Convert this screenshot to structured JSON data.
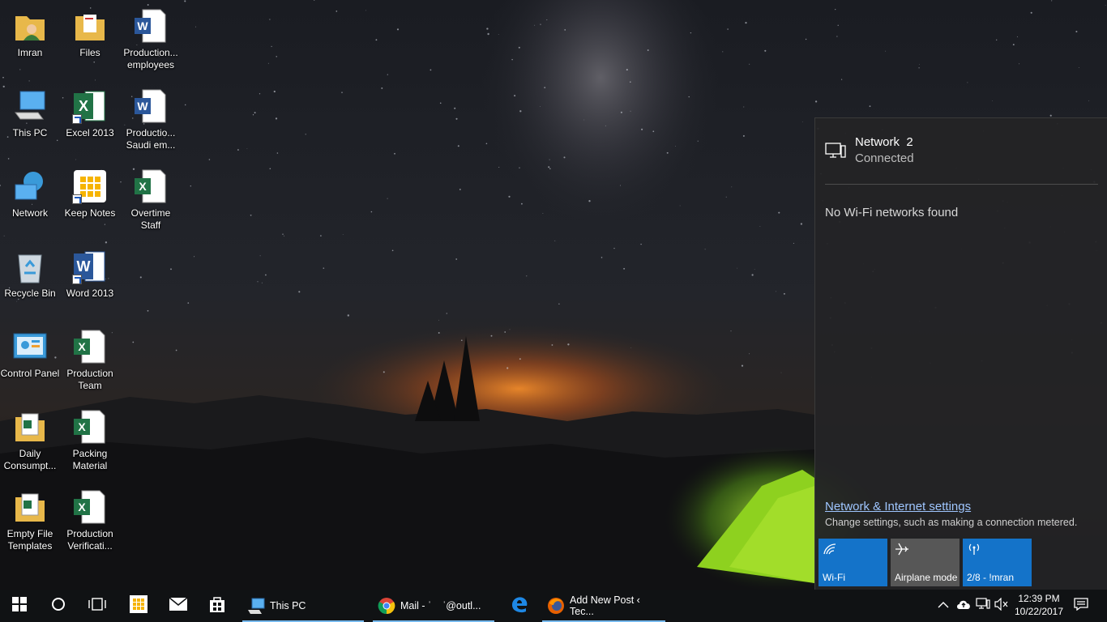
{
  "desktop": {
    "icons": [
      {
        "label": "Imran",
        "type": "user-folder"
      },
      {
        "label": "Files",
        "type": "folder"
      },
      {
        "label": "Production... employees",
        "type": "word-doc"
      },
      {
        "label": "This PC",
        "type": "computer"
      },
      {
        "label": "Excel 2013",
        "type": "excel-shortcut"
      },
      {
        "label": "Productio... Saudi em...",
        "type": "word-doc"
      },
      {
        "label": "Network",
        "type": "network"
      },
      {
        "label": "Keep Notes",
        "type": "keep-notes-shortcut"
      },
      {
        "label": "Overtime Staff",
        "type": "excel-doc"
      },
      {
        "label": "Recycle Bin",
        "type": "recycle-bin"
      },
      {
        "label": "Word 2013",
        "type": "word-shortcut"
      },
      {
        "label": "Control Panel",
        "type": "control-panel"
      },
      {
        "label": "Production Team",
        "type": "excel-doc"
      },
      {
        "label": "Daily Consumpt...",
        "type": "excel-folder"
      },
      {
        "label": "Packing Material",
        "type": "excel-doc"
      },
      {
        "label": "Empty File Templates",
        "type": "excel-folder"
      },
      {
        "label": "Production Verificati...",
        "type": "excel-doc"
      }
    ]
  },
  "network_flyout": {
    "network_name": "Network  2",
    "network_status": "Connected",
    "no_wifi_message": "No Wi-Fi networks found",
    "settings_link": "Network & Internet settings",
    "settings_description": "Change settings, such as making a connection metered.",
    "quick_actions": [
      {
        "label": "Wi-Fi",
        "icon": "wifi-icon",
        "state": "on"
      },
      {
        "label": "Airplane mode",
        "icon": "airplane-icon",
        "state": "off"
      },
      {
        "label": "2/8 - !mran",
        "icon": "mobile-hotspot-icon",
        "state": "on"
      }
    ]
  },
  "taskbar": {
    "apps": [
      {
        "label": "This PC",
        "icon": "file-explorer-icon"
      },
      {
        "label": "Mail - ˈ    ˈ@outl...",
        "icon": "chrome-icon"
      },
      {
        "label": "",
        "icon": "edge-icon"
      },
      {
        "label": "Add New Post ‹ Tec...",
        "icon": "firefox-icon"
      }
    ],
    "clock": {
      "time": "12:39 PM",
      "date": "10/22/2017"
    }
  },
  "colors": {
    "accent": "#1473c9",
    "tile_off": "#575757",
    "link": "#9fc6ff",
    "taskbar": "#101214"
  }
}
